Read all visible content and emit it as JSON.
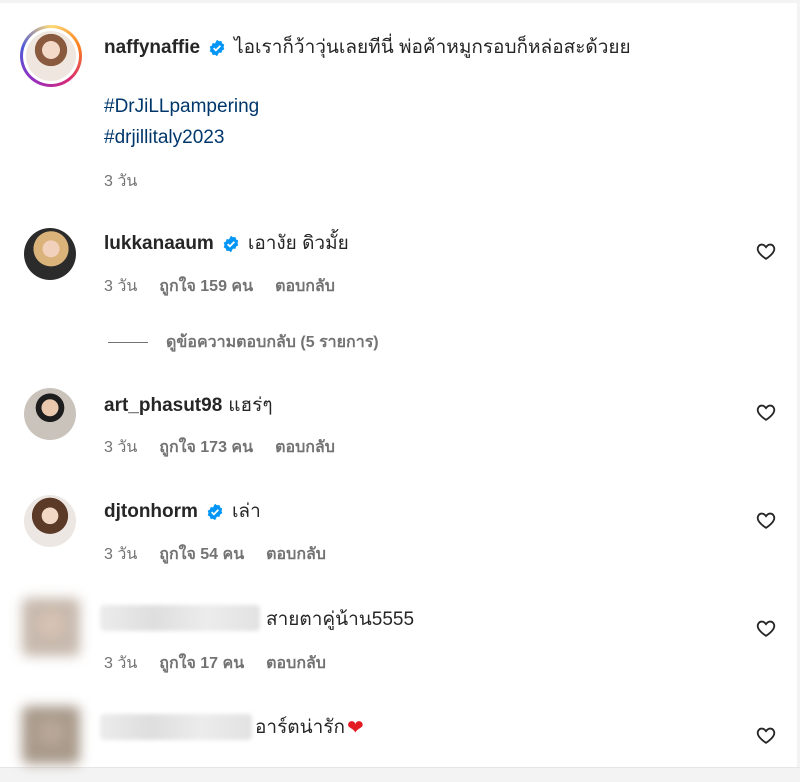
{
  "post": {
    "username": "naffynaffie",
    "caption": "ไอเราก็ว้าวุ่นเลยทีนี่ พ่อค้าหมูกรอบก็หล่อสะด้วยย",
    "hashtags": [
      "#DrJiLLpampering",
      "#drjillitaly2023"
    ],
    "time": "3 วัน"
  },
  "comments": [
    {
      "username": "lukkanaaum",
      "verified": true,
      "text": "เอางัย ดิวมั้ย",
      "time": "3 วัน",
      "likes": "ถูกใจ 159 คน",
      "reply": "ตอบกลับ"
    },
    {
      "username": "art_phasut98",
      "verified": false,
      "text": "แฮร่ๆ",
      "time": "3 วัน",
      "likes": "ถูกใจ 173 คน",
      "reply": "ตอบกลับ"
    },
    {
      "username": "djtonhorm",
      "verified": true,
      "text": "เล่า",
      "time": "3 วัน",
      "likes": "ถูกใจ 54 คน",
      "reply": "ตอบกลับ"
    },
    {
      "username": "",
      "verified": false,
      "text": "สายตาคู่น้าน5555",
      "time": "3 วัน",
      "likes": "ถูกใจ 17 คน",
      "reply": "ตอบกลับ"
    },
    {
      "username": "",
      "verified": false,
      "text": "อาร์ตน่ารัก",
      "emoji": "❤",
      "time": "",
      "likes": "",
      "reply": ""
    }
  ],
  "view_replies": "ดูข้อความตอบกลับ (5 รายการ)",
  "icons": {
    "verified": "verified-badge-icon",
    "like": "heart-outline-icon"
  },
  "colors": {
    "verified": "#0095f6",
    "hashtag": "#00376b",
    "meta": "#737373"
  }
}
